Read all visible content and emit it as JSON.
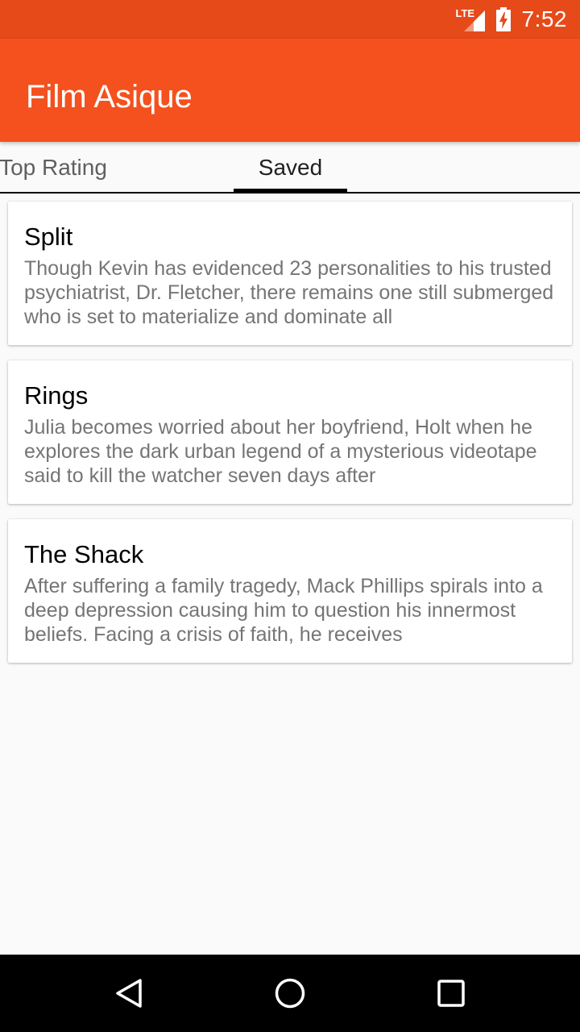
{
  "status_bar": {
    "network": "LTE",
    "time": "7:52",
    "icons": [
      "lte-signal-icon",
      "battery-charging-icon"
    ]
  },
  "app_bar": {
    "title": "Film Asique",
    "color": "#f4511e"
  },
  "tabs": [
    {
      "label": "Top Rating",
      "selected": false
    },
    {
      "label": "Saved",
      "selected": true
    }
  ],
  "movies": [
    {
      "title": "Split",
      "description": "Though Kevin has evidenced 23 personalities to his trusted psychiatrist, Dr. Fletcher, there remains one still submerged who is set to materialize and dominate all"
    },
    {
      "title": "Rings",
      "description": "Julia becomes worried about her boyfriend, Holt when he explores the dark urban legend of a mysterious videotape said to kill the watcher seven days after"
    },
    {
      "title": "The Shack",
      "description": "After suffering a family tragedy, Mack Phillips spirals into a deep depression causing him to question his innermost beliefs. Facing a crisis of faith, he receives"
    }
  ],
  "nav_bar": {
    "icons": [
      "back-icon",
      "home-icon",
      "recents-icon"
    ]
  }
}
